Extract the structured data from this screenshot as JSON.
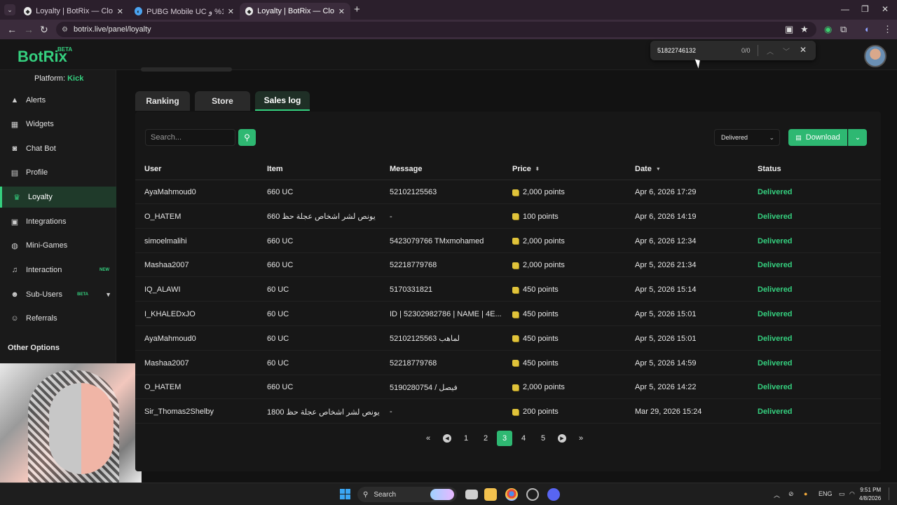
{
  "browser": {
    "tabs": [
      {
        "label": "Loyalty | BotRix — Cloud Streaming",
        "active": false
      },
      {
        "label": "PUBG Mobile UC خصم 10% و |",
        "active": false
      },
      {
        "label": "Loyalty | BotRix — Cloud Streaming",
        "active": true
      }
    ],
    "new_tab": "+",
    "url": "botrix.live/panel/loyalty"
  },
  "find_bar": {
    "query": "51822746132",
    "count": "0/0"
  },
  "app": {
    "logo": "BotRix",
    "logo_badge": "BETA",
    "platform_label": "Platform:",
    "platform_value": "Kick"
  },
  "sidebar": {
    "items": [
      {
        "label": "Alerts",
        "icon": "warning-icon"
      },
      {
        "label": "Widgets",
        "icon": "widgets-icon"
      },
      {
        "label": "Chat Bot",
        "icon": "robot-icon"
      },
      {
        "label": "Profile",
        "icon": "id-card-icon"
      },
      {
        "label": "Loyalty",
        "icon": "trophy-icon",
        "active": true
      },
      {
        "label": "Integrations",
        "icon": "integrations-icon"
      },
      {
        "label": "Mini-Games",
        "icon": "gamepad-icon"
      },
      {
        "label": "Interaction",
        "icon": "music-icon",
        "badge": "NEW"
      },
      {
        "label": "Sub-Users",
        "icon": "users-icon",
        "badge": "BETA"
      },
      {
        "label": "Referrals",
        "icon": "referrals-icon"
      }
    ],
    "other_options": "Other Options"
  },
  "page_tabs": [
    "Ranking",
    "Store",
    "Sales log"
  ],
  "toolbar": {
    "search_placeholder": "Search...",
    "status_filter": "Delivered",
    "download_label": "Download"
  },
  "table": {
    "columns": [
      "User",
      "Item",
      "Message",
      "Price",
      "Date",
      "Status"
    ],
    "rows": [
      {
        "user": "AyaMahmoud0",
        "item": "660 UC",
        "message": "52102125563",
        "price": "2,000 points",
        "date": "Apr 6, 2026 17:29",
        "status": "Delivered"
      },
      {
        "user": "O_HATEM",
        "item": "660 يونص لشر اشخاص عجلة حظ",
        "message": "-",
        "price": "100 points",
        "date": "Apr 6, 2026 14:19",
        "status": "Delivered"
      },
      {
        "user": "simoelmalihi",
        "item": "660 UC",
        "message": "5423079766 TMxmohamed",
        "price": "2,000 points",
        "date": "Apr 6, 2026 12:34",
        "status": "Delivered"
      },
      {
        "user": "Mashaa2007",
        "item": "660 UC",
        "message": "52218779768",
        "price": "2,000 points",
        "date": "Apr 5, 2026 21:34",
        "status": "Delivered"
      },
      {
        "user": "IQ_ALAWI",
        "item": "60 UC",
        "message": "5170331821",
        "price": "450 points",
        "date": "Apr 5, 2026 15:14",
        "status": "Delivered"
      },
      {
        "user": "I_KHALEDxJO",
        "item": "60 UC",
        "message": "ID | 52302982786 | NAME | 4E...",
        "price": "450 points",
        "date": "Apr 5, 2026 15:01",
        "status": "Delivered"
      },
      {
        "user": "AyaMahmoud0",
        "item": "60 UC",
        "message": "52102125563 لماهب",
        "price": "450 points",
        "date": "Apr 5, 2026 15:01",
        "status": "Delivered"
      },
      {
        "user": "Mashaa2007",
        "item": "60 UC",
        "message": "52218779768",
        "price": "450 points",
        "date": "Apr 5, 2026 14:59",
        "status": "Delivered"
      },
      {
        "user": "O_HATEM",
        "item": "660 UC",
        "message": "5190280754 / فيصل",
        "price": "2,000 points",
        "date": "Apr 5, 2026 14:22",
        "status": "Delivered"
      },
      {
        "user": "Sir_Thomas2Shelby",
        "item": "1800 يونص لشر اشخاص عجلة حظ",
        "message": "-",
        "price": "200 points",
        "date": "Mar 29, 2026 15:24",
        "status": "Delivered"
      }
    ]
  },
  "pagination": {
    "pages": [
      "1",
      "2",
      "3",
      "4",
      "5"
    ],
    "current": "3"
  },
  "taskbar": {
    "search_label": "Search",
    "lang": "ENG",
    "time": "9:51 PM",
    "date": "4/8/2026"
  }
}
